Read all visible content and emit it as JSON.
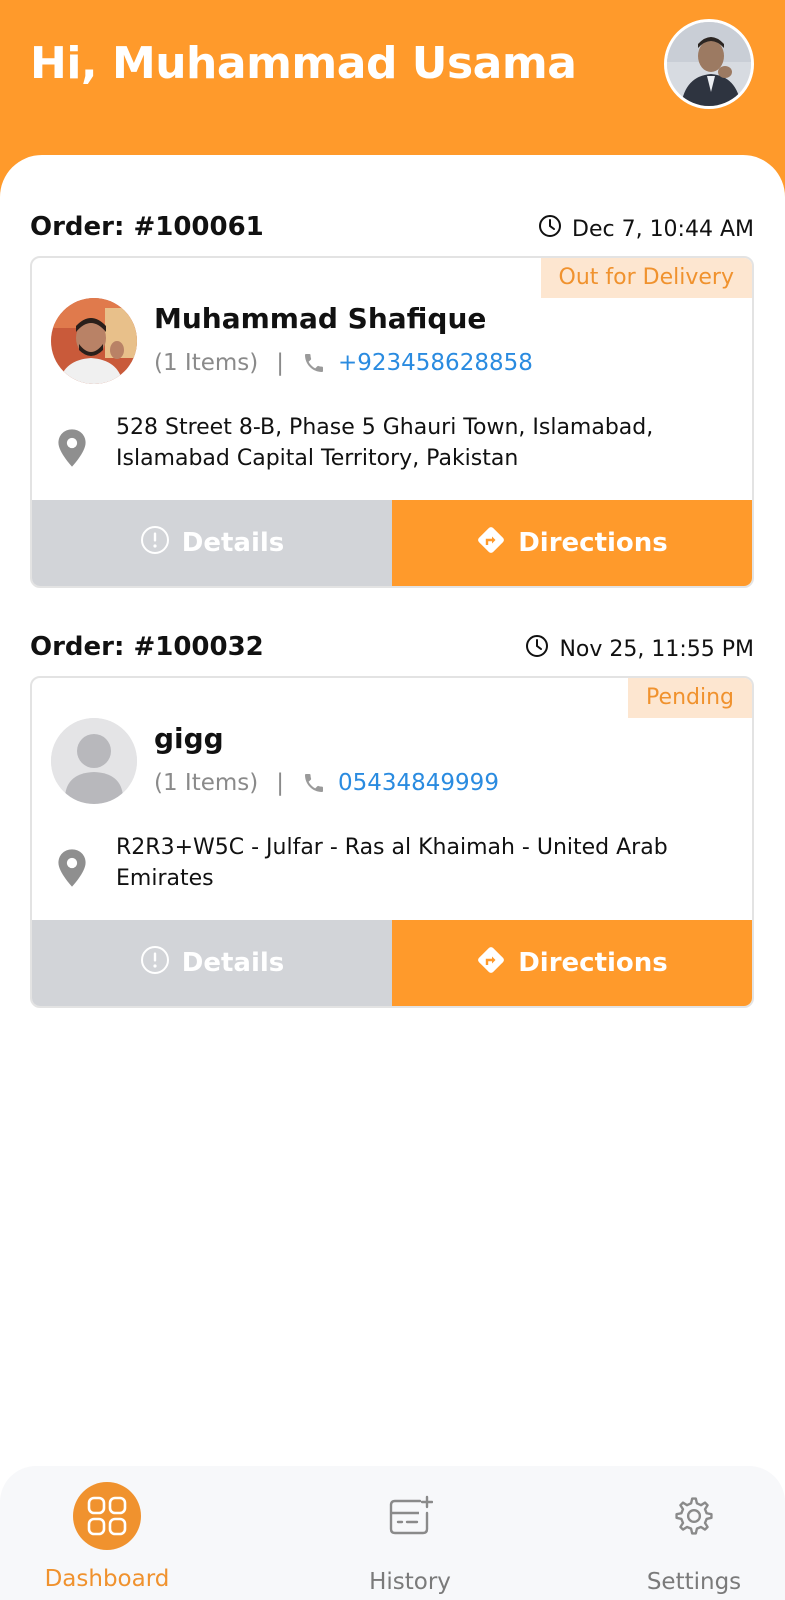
{
  "header": {
    "greeting": "Hi, Muhammad Usama"
  },
  "orders": [
    {
      "id": "Order: #100061",
      "time": "Dec 7, 10:44 AM",
      "status": "Out for Delivery",
      "customer": "Muhammad Shafique",
      "items": "(1 Items)",
      "phone": "+923458628858",
      "address": "528 Street 8-B, Phase 5 Ghauri Town, Islamabad, Islamabad Capital Territory, Pakistan",
      "details_label": "Details",
      "directions_label": "Directions"
    },
    {
      "id": "Order: #100032",
      "time": "Nov 25, 11:55 PM",
      "status": "Pending",
      "customer": "gigg",
      "items": "(1 Items)",
      "phone": "05434849999",
      "address": "R2R3+W5C - Julfar - Ras al Khaimah - United Arab Emirates",
      "details_label": "Details",
      "directions_label": "Directions"
    }
  ],
  "nav": {
    "items": [
      {
        "label": "Dashboard",
        "icon": "grid-icon",
        "active": true
      },
      {
        "label": "History",
        "icon": "history-icon",
        "active": false
      },
      {
        "label": "Settings",
        "icon": "gear-icon",
        "active": false
      }
    ]
  },
  "colors": {
    "accent": "#FF9A2B",
    "badge_bg": "#FDE6D0",
    "badge_text": "#F0922E",
    "phone_link": "#2A8BE0",
    "details_bg": "#D2D4D8"
  },
  "separator": "|"
}
